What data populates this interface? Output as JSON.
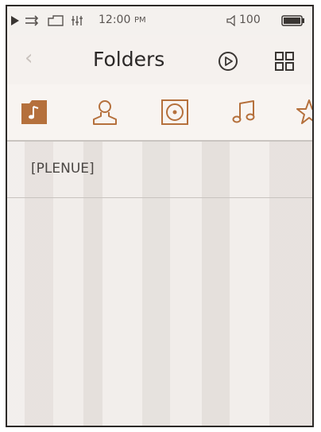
{
  "status_bar": {
    "time": "12:00",
    "period": "PM",
    "battery_level": "100",
    "icons": [
      "play-indicator-icon",
      "repeat-icon",
      "folder-icon",
      "equalizer-icon",
      "volume-icon",
      "battery-icon"
    ]
  },
  "title_bar": {
    "back_icon": "‹",
    "title": "Folders",
    "play_icon": "play-icon",
    "grid_icon": "grid-icon"
  },
  "tabs": [
    {
      "name": "folders",
      "icon": "music-folder-icon",
      "active": true
    },
    {
      "name": "artists",
      "icon": "artist-icon",
      "active": false
    },
    {
      "name": "albums",
      "icon": "album-icon",
      "active": false
    },
    {
      "name": "songs",
      "icon": "music-note-icon",
      "active": false
    },
    {
      "name": "favorites",
      "icon": "star-icon",
      "active": false
    }
  ],
  "list": [
    {
      "label": "[PLENUE]"
    }
  ],
  "colors": {
    "accent": "#b5703c",
    "background": "#ece7e3"
  }
}
